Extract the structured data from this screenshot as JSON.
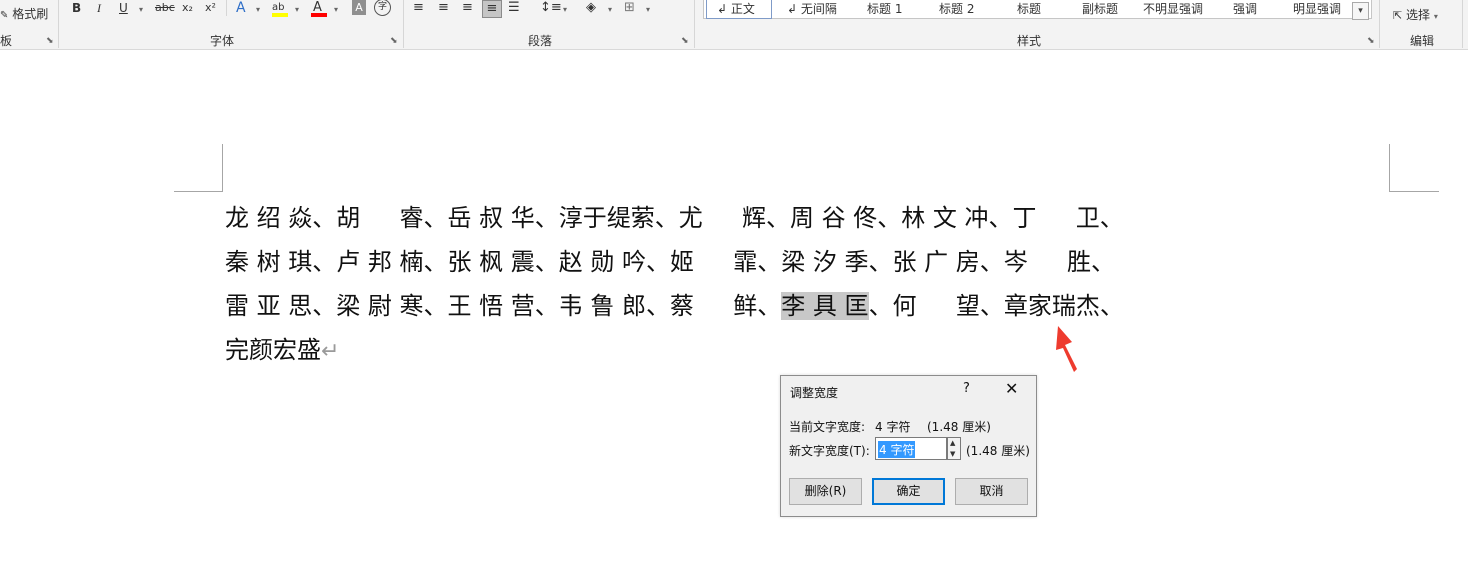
{
  "ribbon": {
    "format_painter": "格式刷",
    "clipboard_group_partial": "板",
    "font_group": "字体",
    "paragraph_group": "段落",
    "styles_group": "样式",
    "editing_group": "编辑",
    "select": "选择",
    "font_buttons": {
      "bold": "B",
      "italic": "I",
      "underline": "U",
      "strikethrough": "abc",
      "subscript": "x₂",
      "superscript": "x²",
      "text_effects": "A",
      "highlight": "ab",
      "font_color": "A",
      "char_shading": "A",
      "enclose": "字"
    },
    "styles": [
      {
        "label": "↲ 正文",
        "active": true
      },
      {
        "label": "↲ 无间隔",
        "active": false
      },
      {
        "label": "标题 1",
        "active": false
      },
      {
        "label": "标题 2",
        "active": false
      },
      {
        "label": "标题",
        "active": false
      },
      {
        "label": "副标题",
        "active": false
      },
      {
        "label": "不明显强调",
        "active": false
      },
      {
        "label": "强调",
        "active": false
      },
      {
        "label": "明显强调",
        "active": false
      }
    ],
    "colors": {
      "highlight_bar": "#ffff00",
      "font_color_bar": "#ff0000",
      "text_effects": "#2f6fc8"
    }
  },
  "document": {
    "line1": "龙 绍 焱、胡 　 睿、岳 叔 华、淳于缇萦、尤 　 辉、周 谷 佟、林 文 冲、丁 　 卫、",
    "line2": "秦 树 琪、卢 邦 楠、张 枫 震、赵 勋 吟、姬 　 霏、梁 汐 季、张 广 房、岑 　 胜、",
    "line3_before": "雷 亚 思、梁 尉 寒、王 悟 营、韦 鲁 郎、蔡 　 鲜、",
    "line3_selected": "李 具 匡",
    "line3_after": "、何 　 望、章家瑞杰、",
    "line4": "完颜宏盛",
    "pilcrow": "↵"
  },
  "dialog": {
    "title": "调整宽度",
    "help": "?",
    "close": "✕",
    "current_label": "当前文字宽度:",
    "current_value": "4 字符",
    "current_cm": "(1.48 厘米)",
    "new_label": "新文字宽度(T):",
    "new_value": "4 字符",
    "new_cm": "(1.48 厘米)",
    "delete_button": "删除(R)",
    "ok_button": "确定",
    "cancel_button": "取消"
  },
  "annotation_color": "#ee3b2e"
}
